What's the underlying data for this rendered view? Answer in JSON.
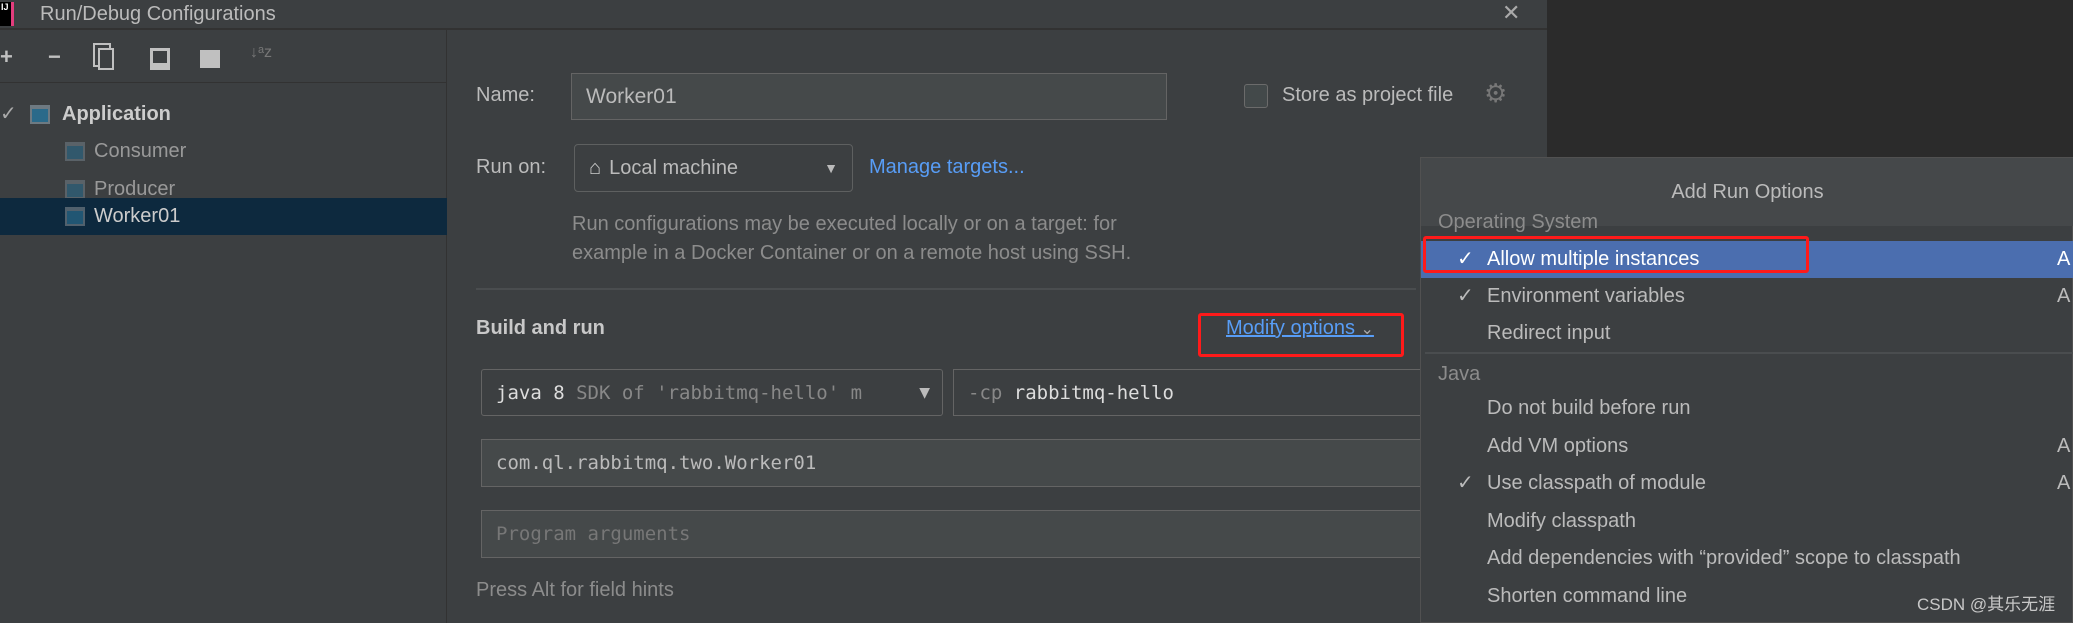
{
  "window": {
    "title": "Run/Debug Configurations",
    "logo": "IJ"
  },
  "toolbar": {
    "icons": [
      "plus-icon",
      "minus-icon",
      "copy-icon",
      "save-icon",
      "new-folder-icon",
      "sort-alpha-icon"
    ],
    "add": "+",
    "remove": "−",
    "sort": "↓ᵃz"
  },
  "tree": {
    "root": "Application",
    "children": [
      "Consumer",
      "Producer",
      "Worker01"
    ],
    "selected": "Worker01"
  },
  "form": {
    "name_label": "Name:",
    "name_value": "Worker01",
    "store_label": "Store as project file",
    "store_checked": false,
    "run_on_label": "Run on:",
    "run_on_value": "Local machine",
    "manage_targets": "Manage targets...",
    "desc_line1": "Run configurations may be executed locally or on a target: for",
    "desc_line2": "example in a Docker Container or on a remote host using SSH.",
    "build_run": "Build and run",
    "modify_options": "Modify options",
    "jdk_bold": "java 8",
    "jdk_rest": " SDK of 'rabbitmq-hello' m",
    "cp_prefix": "-cp",
    "cp_value": " rabbitmq-hello",
    "main_class": "com.ql.rabbitmq.two.Worker01",
    "program_args_placeholder": "Program arguments",
    "hint": "Press Alt for field hints"
  },
  "popup": {
    "title": "Add Run Options",
    "groups": [
      {
        "name": "Operating System",
        "items": [
          {
            "label": "Allow multiple instances",
            "checked": true,
            "highlighted": true,
            "shortcut": "A"
          },
          {
            "label": "Environment variables",
            "checked": true,
            "shortcut": "A"
          },
          {
            "label": "Redirect input",
            "checked": false,
            "shortcut": ""
          }
        ]
      },
      {
        "name": "Java",
        "items": [
          {
            "label": "Do not build before run",
            "checked": false,
            "shortcut": ""
          },
          {
            "label": "Add VM options",
            "checked": false,
            "shortcut": "A"
          },
          {
            "label": "Use classpath of module",
            "checked": true,
            "shortcut": "A"
          },
          {
            "label": "Modify classpath",
            "checked": false,
            "shortcut": ""
          },
          {
            "label": "Add dependencies with “provided” scope to classpath",
            "checked": false,
            "shortcut": ""
          },
          {
            "label": "Shorten command line",
            "checked": false,
            "shortcut": ""
          }
        ]
      }
    ]
  },
  "colors": {
    "highlight": "#4b6eaf",
    "annotation": "#ff1a1a",
    "link": "#589df6",
    "selection": "#0d293e"
  },
  "watermark": "CSDN @其乐无涯"
}
